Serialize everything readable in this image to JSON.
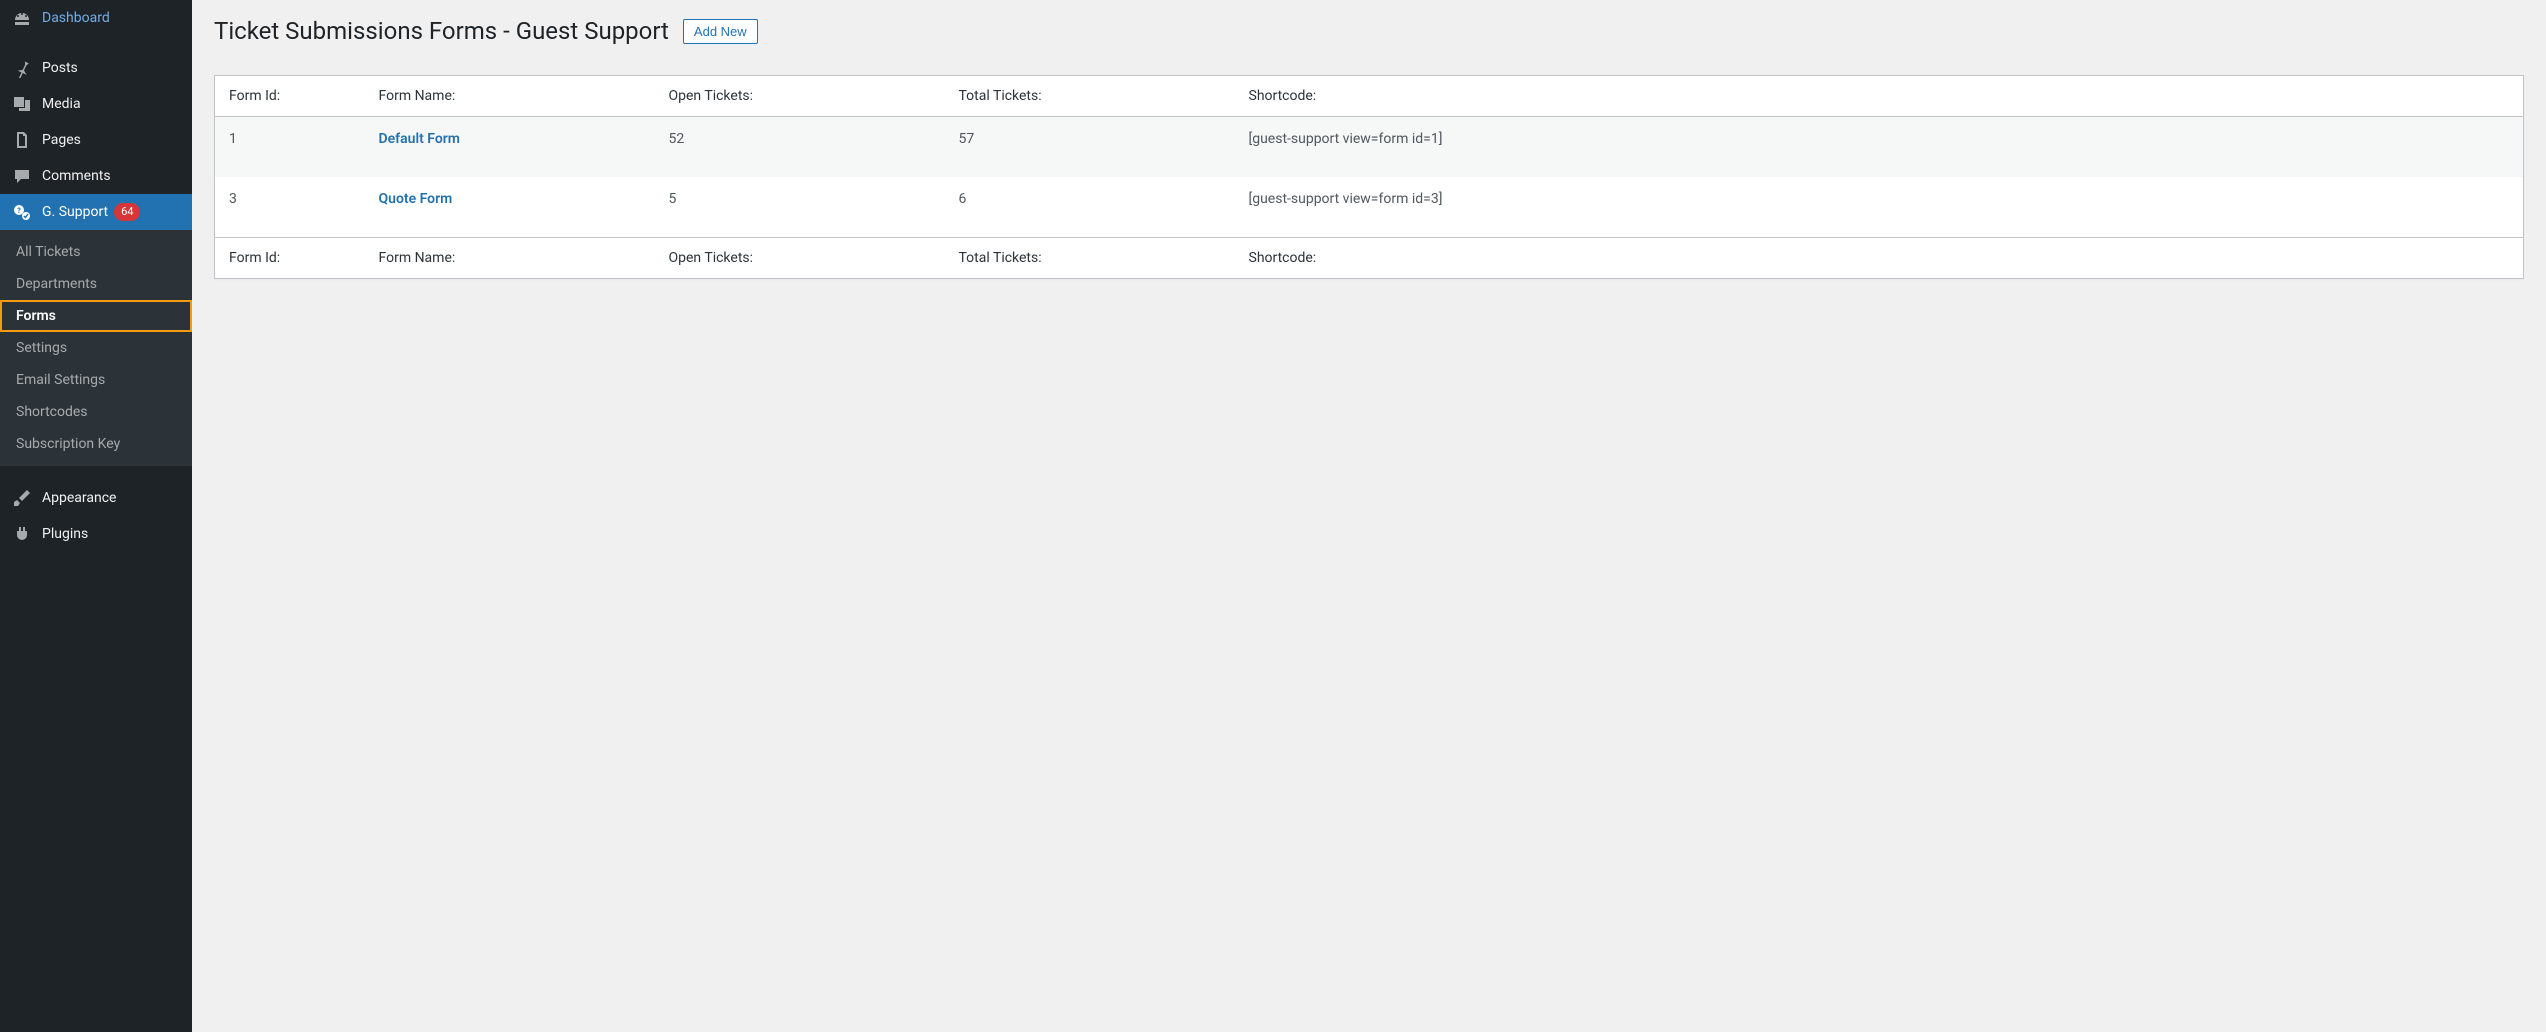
{
  "sidebar": {
    "menu": [
      {
        "id": "dashboard",
        "label": "Dashboard",
        "icon": "dashboard"
      },
      {
        "id": "posts",
        "label": "Posts",
        "icon": "pin"
      },
      {
        "id": "media",
        "label": "Media",
        "icon": "media"
      },
      {
        "id": "pages",
        "label": "Pages",
        "icon": "pages"
      },
      {
        "id": "comments",
        "label": "Comments",
        "icon": "comment"
      },
      {
        "id": "gsupport",
        "label": "G. Support",
        "icon": "support",
        "badge": "64",
        "current": true
      },
      {
        "id": "appearance",
        "label": "Appearance",
        "icon": "brush"
      },
      {
        "id": "plugins",
        "label": "Plugins",
        "icon": "plug"
      }
    ],
    "submenu": [
      {
        "label": "All Tickets"
      },
      {
        "label": "Departments"
      },
      {
        "label": "Forms",
        "active": true,
        "highlighted": true
      },
      {
        "label": "Settings"
      },
      {
        "label": "Email Settings"
      },
      {
        "label": "Shortcodes"
      },
      {
        "label": "Subscription Key"
      }
    ]
  },
  "page": {
    "title": "Ticket Submissions Forms - Guest Support",
    "add_new": "Add New"
  },
  "table": {
    "headers": {
      "form_id": "Form Id:",
      "form_name": "Form Name:",
      "open": "Open Tickets:",
      "total": "Total Tickets:",
      "shortcode": "Shortcode:"
    },
    "rows": [
      {
        "id": "1",
        "name": "Default Form",
        "open": "52",
        "total": "57",
        "shortcode": "[guest-support view=form id=1]"
      },
      {
        "id": "3",
        "name": "Quote Form",
        "open": "5",
        "total": "6",
        "shortcode": "[guest-support view=form id=3]"
      }
    ]
  }
}
